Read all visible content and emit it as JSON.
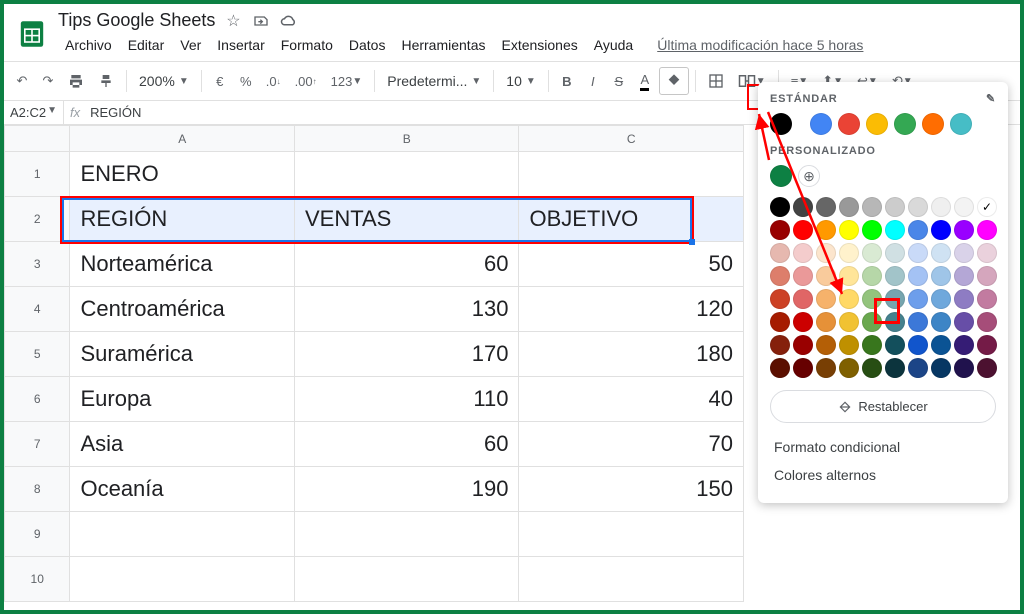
{
  "doc": {
    "title": "Tips Google Sheets"
  },
  "menus": [
    "Archivo",
    "Editar",
    "Ver",
    "Insertar",
    "Formato",
    "Datos",
    "Herramientas",
    "Extensiones",
    "Ayuda"
  ],
  "last_modified": "Última modificación hace 5 horas",
  "toolbar": {
    "zoom": "200%",
    "font": "Predetermi...",
    "size": "10"
  },
  "formula_bar": {
    "range": "A2:C2",
    "fx_label": "fx",
    "value": "REGIÓN"
  },
  "columns": [
    "A",
    "B",
    "C"
  ],
  "row_numbers": [
    "1",
    "2",
    "3",
    "4",
    "5",
    "6",
    "7",
    "8",
    "9",
    "10"
  ],
  "table": {
    "title_cell": "ENERO",
    "headers": [
      "REGIÓN",
      "VENTAS",
      "OBJETIVO"
    ],
    "rows": [
      {
        "region": "Norteamérica",
        "ventas": "60",
        "objetivo": "50"
      },
      {
        "region": "Centroamérica",
        "ventas": "130",
        "objetivo": "120"
      },
      {
        "region": "Suramérica",
        "ventas": "170",
        "objetivo": "180"
      },
      {
        "region": "Europa",
        "ventas": "110",
        "objetivo": "40"
      },
      {
        "region": "Asia",
        "ventas": "60",
        "objetivo": "70"
      },
      {
        "region": "Oceanía",
        "ventas": "190",
        "objetivo": "150"
      }
    ]
  },
  "picker": {
    "standard_label": "ESTÁNDAR",
    "custom_label": "PERSONALIZADO",
    "reset_label": "Restablecer",
    "conditional_label": "Formato condicional",
    "altern_label": "Colores alternos",
    "standard_colors": [
      "#000000",
      "#ea4335",
      "#ff6d01",
      "#ffab00",
      "#34a853",
      "#00acc1",
      "#4285f4",
      "#a142f4"
    ],
    "standard_big": [
      "#ffffff",
      "#4285f4",
      "#ea4335",
      "#fbbc04",
      "#34a853",
      "#ff6d01",
      "#46bdc6"
    ],
    "custom_current": "#0d8043",
    "palette": [
      [
        "#000000",
        "#434343",
        "#666666",
        "#999999",
        "#b7b7b7",
        "#cccccc",
        "#d9d9d9",
        "#efefef",
        "#f3f3f3",
        "#ffffff"
      ],
      [
        "#980000",
        "#ff0000",
        "#ff9900",
        "#ffff00",
        "#00ff00",
        "#00ffff",
        "#4a86e8",
        "#0000ff",
        "#9900ff",
        "#ff00ff"
      ],
      [
        "#e6b8af",
        "#f4cccc",
        "#fce5cd",
        "#fff2cc",
        "#d9ead3",
        "#d0e0e3",
        "#c9daf8",
        "#cfe2f3",
        "#d9d2e9",
        "#ead1dc"
      ],
      [
        "#dd7e6b",
        "#ea9999",
        "#f9cb9c",
        "#ffe599",
        "#b6d7a8",
        "#a2c4c9",
        "#a4c2f4",
        "#9fc5e8",
        "#b4a7d6",
        "#d5a6bd"
      ],
      [
        "#cc4125",
        "#e06666",
        "#f6b26b",
        "#ffd966",
        "#93c47d",
        "#76a5af",
        "#6d9eeb",
        "#6fa8dc",
        "#8e7cc3",
        "#c27ba0"
      ],
      [
        "#a61c00",
        "#cc0000",
        "#e69138",
        "#f1c232",
        "#6aa84f",
        "#45818e",
        "#3c78d8",
        "#3d85c6",
        "#674ea7",
        "#a64d79"
      ],
      [
        "#85200c",
        "#990000",
        "#b45f06",
        "#bf9000",
        "#38761d",
        "#134f5c",
        "#1155cc",
        "#0b5394",
        "#351c75",
        "#741b47"
      ],
      [
        "#5b0f00",
        "#660000",
        "#783f04",
        "#7f6000",
        "#274e13",
        "#0c343d",
        "#1c4587",
        "#073763",
        "#20124d",
        "#4c1130"
      ]
    ]
  }
}
